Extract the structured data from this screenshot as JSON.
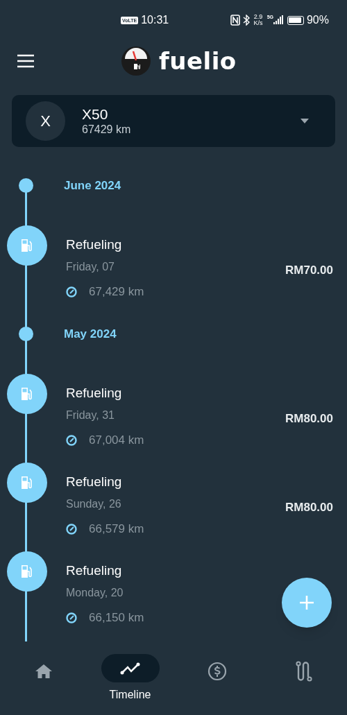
{
  "status_bar": {
    "volte": "VoLTE",
    "time": "10:31",
    "speed_value": "2.9",
    "speed_unit": "K/s",
    "network": "5G",
    "battery": "90%"
  },
  "app_bar": {
    "title": "fuelio"
  },
  "vehicle": {
    "initial": "X",
    "name": "X50",
    "odometer": "67429 km"
  },
  "timeline": [
    {
      "kind": "month",
      "label": "June 2024"
    },
    {
      "kind": "entry",
      "title": "Refueling",
      "date": "Friday, 07",
      "odometer": "67,429 km",
      "price": "RM70.00"
    },
    {
      "kind": "month",
      "label": "May 2024"
    },
    {
      "kind": "entry",
      "title": "Refueling",
      "date": "Friday, 31",
      "odometer": "67,004 km",
      "price": "RM80.00"
    },
    {
      "kind": "entry",
      "title": "Refueling",
      "date": "Sunday, 26",
      "odometer": "66,579 km",
      "price": "RM80.00"
    },
    {
      "kind": "entry",
      "title": "Refueling",
      "date": "Monday, 20",
      "odometer": "66,150 km"
    }
  ],
  "bottom_nav": [
    {
      "kind": "home",
      "selected": false
    },
    {
      "kind": "timeline",
      "label": "Timeline",
      "selected": true
    },
    {
      "kind": "costs",
      "selected": false
    },
    {
      "kind": "route",
      "selected": false
    }
  ]
}
